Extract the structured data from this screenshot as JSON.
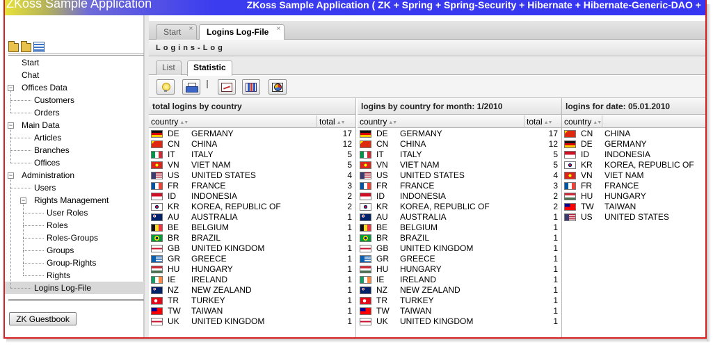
{
  "header": {
    "app_title": "ZKoss Sample Application",
    "app_subtitle": "ZKoss Sample Application ( ZK + Spring + Spring-Security + Hibernate + Hibernate-Generic-DAO +"
  },
  "sidebar": {
    "icons": [
      "folder-open-icon",
      "folder-closed-icon",
      "list-icon"
    ],
    "tree": [
      {
        "label": "Start",
        "level": 0
      },
      {
        "label": "Chat",
        "level": 0
      },
      {
        "label": "Offices Data",
        "level": 0,
        "toggle": "−"
      },
      {
        "label": "Customers",
        "level": 1
      },
      {
        "label": "Orders",
        "level": 1
      },
      {
        "label": "Main Data",
        "level": 0,
        "toggle": "−"
      },
      {
        "label": "Articles",
        "level": 1
      },
      {
        "label": "Branches",
        "level": 1
      },
      {
        "label": "Offices",
        "level": 1
      },
      {
        "label": "Administration",
        "level": 0,
        "toggle": "−"
      },
      {
        "label": "Users",
        "level": 1
      },
      {
        "label": "Rights Management",
        "level": 1,
        "toggle": "−"
      },
      {
        "label": "User Roles",
        "level": 2
      },
      {
        "label": "Roles",
        "level": 2
      },
      {
        "label": "Roles-Groups",
        "level": 2
      },
      {
        "label": "Groups",
        "level": 2
      },
      {
        "label": "Group-Rights",
        "level": 2
      },
      {
        "label": "Rights",
        "level": 2
      },
      {
        "label": "Logins Log-File",
        "level": 1,
        "selected": true
      }
    ],
    "guestbook_label": "ZK Guestbook"
  },
  "tabs": [
    {
      "label": "Start",
      "close": "×",
      "active": false
    },
    {
      "label": "Logins Log-File",
      "close": "×",
      "active": true
    }
  ],
  "panel_title": "Logins-Log",
  "subtabs": [
    {
      "label": "List",
      "active": false
    },
    {
      "label": "Statistic",
      "active": true
    }
  ],
  "toolbar": {
    "buttons": [
      "bulb-icon",
      "print-icon",
      "line-chart-icon",
      "bar-chart-icon",
      "pie-chart-icon"
    ]
  },
  "grids": [
    {
      "caption": "total logins by country",
      "columns": [
        "country",
        "total"
      ],
      "rows": [
        {
          "flag": "de",
          "code": "DE",
          "name": "GERMANY",
          "total": "17"
        },
        {
          "flag": "cn",
          "code": "CN",
          "name": "CHINA",
          "total": "12"
        },
        {
          "flag": "it",
          "code": "IT",
          "name": "ITALY",
          "total": "5"
        },
        {
          "flag": "vn",
          "code": "VN",
          "name": "VIET NAM",
          "total": "5"
        },
        {
          "flag": "us",
          "code": "US",
          "name": "UNITED STATES",
          "total": "4"
        },
        {
          "flag": "fr",
          "code": "FR",
          "name": "FRANCE",
          "total": "3"
        },
        {
          "flag": "id",
          "code": "ID",
          "name": "INDONESIA",
          "total": "2"
        },
        {
          "flag": "kr",
          "code": "KR",
          "name": "KOREA, REPUBLIC OF",
          "total": "2"
        },
        {
          "flag": "au",
          "code": "AU",
          "name": "AUSTRALIA",
          "total": "1"
        },
        {
          "flag": "be",
          "code": "BE",
          "name": "BELGIUM",
          "total": "1"
        },
        {
          "flag": "br",
          "code": "BR",
          "name": "BRAZIL",
          "total": "1"
        },
        {
          "flag": "gb",
          "code": "GB",
          "name": "UNITED KINGDOM",
          "total": "1"
        },
        {
          "flag": "gr",
          "code": "GR",
          "name": "GREECE",
          "total": "1"
        },
        {
          "flag": "hu",
          "code": "HU",
          "name": "HUNGARY",
          "total": "1"
        },
        {
          "flag": "ie",
          "code": "IE",
          "name": "IRELAND",
          "total": "1"
        },
        {
          "flag": "nz",
          "code": "NZ",
          "name": "NEW ZEALAND",
          "total": "1"
        },
        {
          "flag": "tr",
          "code": "TR",
          "name": "TURKEY",
          "total": "1"
        },
        {
          "flag": "tw",
          "code": "TW",
          "name": "TAIWAN",
          "total": "1"
        },
        {
          "flag": "gb",
          "code": "UK",
          "name": "UNITED KINGDOM",
          "total": "1"
        }
      ]
    },
    {
      "caption": "logins by country for month: 1/2010",
      "columns": [
        "country",
        "total"
      ],
      "rows": [
        {
          "flag": "de",
          "code": "DE",
          "name": "GERMANY",
          "total": "17"
        },
        {
          "flag": "cn",
          "code": "CN",
          "name": "CHINA",
          "total": "12"
        },
        {
          "flag": "it",
          "code": "IT",
          "name": "ITALY",
          "total": "5"
        },
        {
          "flag": "vn",
          "code": "VN",
          "name": "VIET NAM",
          "total": "5"
        },
        {
          "flag": "us",
          "code": "US",
          "name": "UNITED STATES",
          "total": "4"
        },
        {
          "flag": "fr",
          "code": "FR",
          "name": "FRANCE",
          "total": "3"
        },
        {
          "flag": "id",
          "code": "ID",
          "name": "INDONESIA",
          "total": "2"
        },
        {
          "flag": "kr",
          "code": "KR",
          "name": "KOREA, REPUBLIC OF",
          "total": "2"
        },
        {
          "flag": "au",
          "code": "AU",
          "name": "AUSTRALIA",
          "total": "1"
        },
        {
          "flag": "be",
          "code": "BE",
          "name": "BELGIUM",
          "total": "1"
        },
        {
          "flag": "br",
          "code": "BR",
          "name": "BRAZIL",
          "total": "1"
        },
        {
          "flag": "gb",
          "code": "GB",
          "name": "UNITED KINGDOM",
          "total": "1"
        },
        {
          "flag": "gr",
          "code": "GR",
          "name": "GREECE",
          "total": "1"
        },
        {
          "flag": "hu",
          "code": "HU",
          "name": "HUNGARY",
          "total": "1"
        },
        {
          "flag": "ie",
          "code": "IE",
          "name": "IRELAND",
          "total": "1"
        },
        {
          "flag": "nz",
          "code": "NZ",
          "name": "NEW ZEALAND",
          "total": "1"
        },
        {
          "flag": "tr",
          "code": "TR",
          "name": "TURKEY",
          "total": "1"
        },
        {
          "flag": "tw",
          "code": "TW",
          "name": "TAIWAN",
          "total": "1"
        },
        {
          "flag": "gb",
          "code": "UK",
          "name": "UNITED KINGDOM",
          "total": "1"
        }
      ]
    },
    {
      "caption": "logins for date: 05.01.2010",
      "columns": [
        "country"
      ],
      "rows": [
        {
          "flag": "cn",
          "code": "CN",
          "name": "CHINA"
        },
        {
          "flag": "de",
          "code": "DE",
          "name": "GERMANY"
        },
        {
          "flag": "id",
          "code": "ID",
          "name": "INDONESIA"
        },
        {
          "flag": "kr",
          "code": "KR",
          "name": "KOREA, REPUBLIC OF"
        },
        {
          "flag": "vn",
          "code": "VN",
          "name": "VIET NAM"
        },
        {
          "flag": "fr",
          "code": "FR",
          "name": "FRANCE"
        },
        {
          "flag": "hu",
          "code": "HU",
          "name": "HUNGARY"
        },
        {
          "flag": "tw",
          "code": "TW",
          "name": "TAIWAN"
        },
        {
          "flag": "us",
          "code": "US",
          "name": "UNITED STATES"
        }
      ]
    }
  ],
  "colors": {
    "banner_blue": "#3535f2",
    "frame_red": "#d71f1f",
    "selected_row": "#d8d8d8"
  }
}
